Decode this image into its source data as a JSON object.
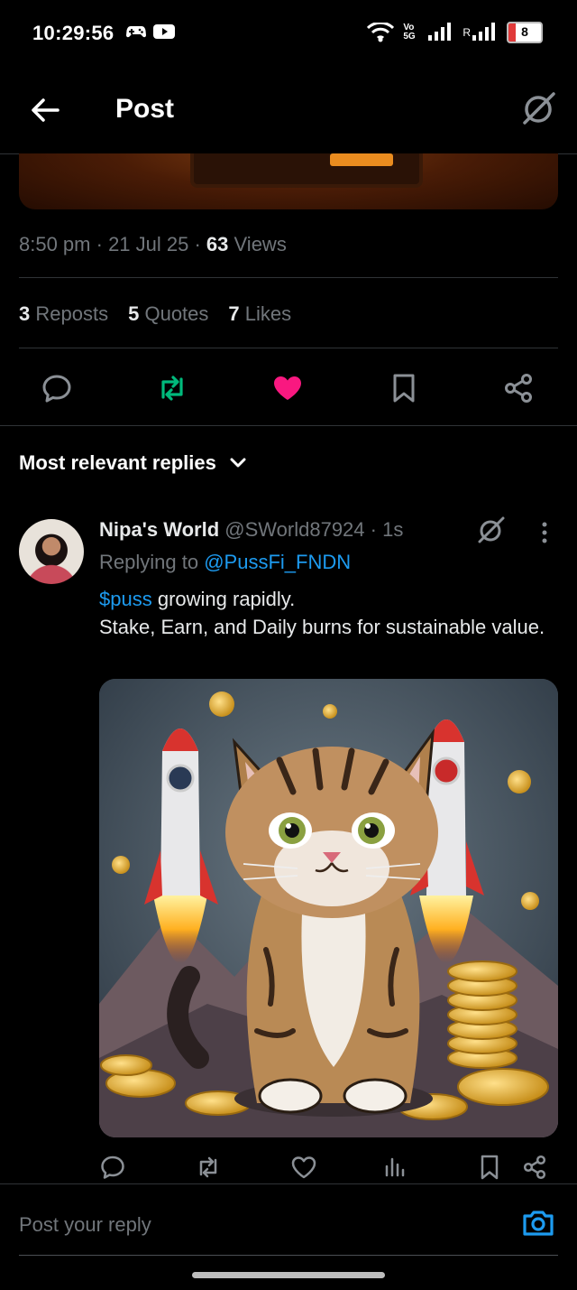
{
  "status": {
    "time": "10:29:56",
    "battery": "8",
    "network_label": "Vo 5G",
    "roaming_label": "R",
    "icons": [
      "game-controller-icon",
      "youtube-icon",
      "wifi-icon",
      "signal-icon",
      "signal-icon",
      "battery-icon"
    ]
  },
  "header": {
    "title": "Post",
    "back_icon": "arrow-left-icon",
    "grok_icon": "grok-icon"
  },
  "post": {
    "time": "8:50 pm",
    "date": "21 Jul 25",
    "views_count": "63",
    "views_label": "Views",
    "reposts_count": "3",
    "reposts_label": "Reposts",
    "quotes_count": "5",
    "quotes_label": "Quotes",
    "likes_count": "7",
    "likes_label": "Likes",
    "colors": {
      "repost": "#00ba7c",
      "like": "#f91880"
    }
  },
  "replies": {
    "sort_label": "Most relevant replies",
    "items": [
      {
        "name": "Nipa's World",
        "handle": "@SWorld87924",
        "age": "1s",
        "replying_prefix": "Replying to",
        "replying_to": "@PussFi_FNDN",
        "cashtag": "$puss",
        "text_line1": " growing rapidly.",
        "text_line2": "Stake, Earn, and Daily burns for sustainable value."
      }
    ]
  },
  "composer": {
    "placeholder": "Post your reply",
    "camera_icon": "camera-icon"
  },
  "theme": {
    "background": "#000000",
    "text": "#e7e9ea",
    "muted": "#71767b",
    "accent": "#1d9bf0"
  }
}
